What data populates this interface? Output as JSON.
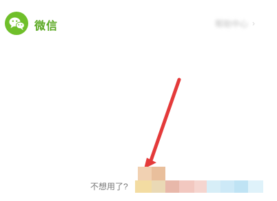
{
  "header": {
    "app_name": "微信",
    "top_right_blurred_text": "帮助中心"
  },
  "footer": {
    "hint_text": "不想用了?"
  },
  "icons": {
    "logo": "wechat-logo-icon",
    "chevron": "chevron-right-icon",
    "arrow": "red-arrow-annotation-icon"
  },
  "colors": {
    "brand_green": "#6fbf2a",
    "brand_text_green": "#5aa821",
    "annotation_red": "#e43a3a"
  }
}
